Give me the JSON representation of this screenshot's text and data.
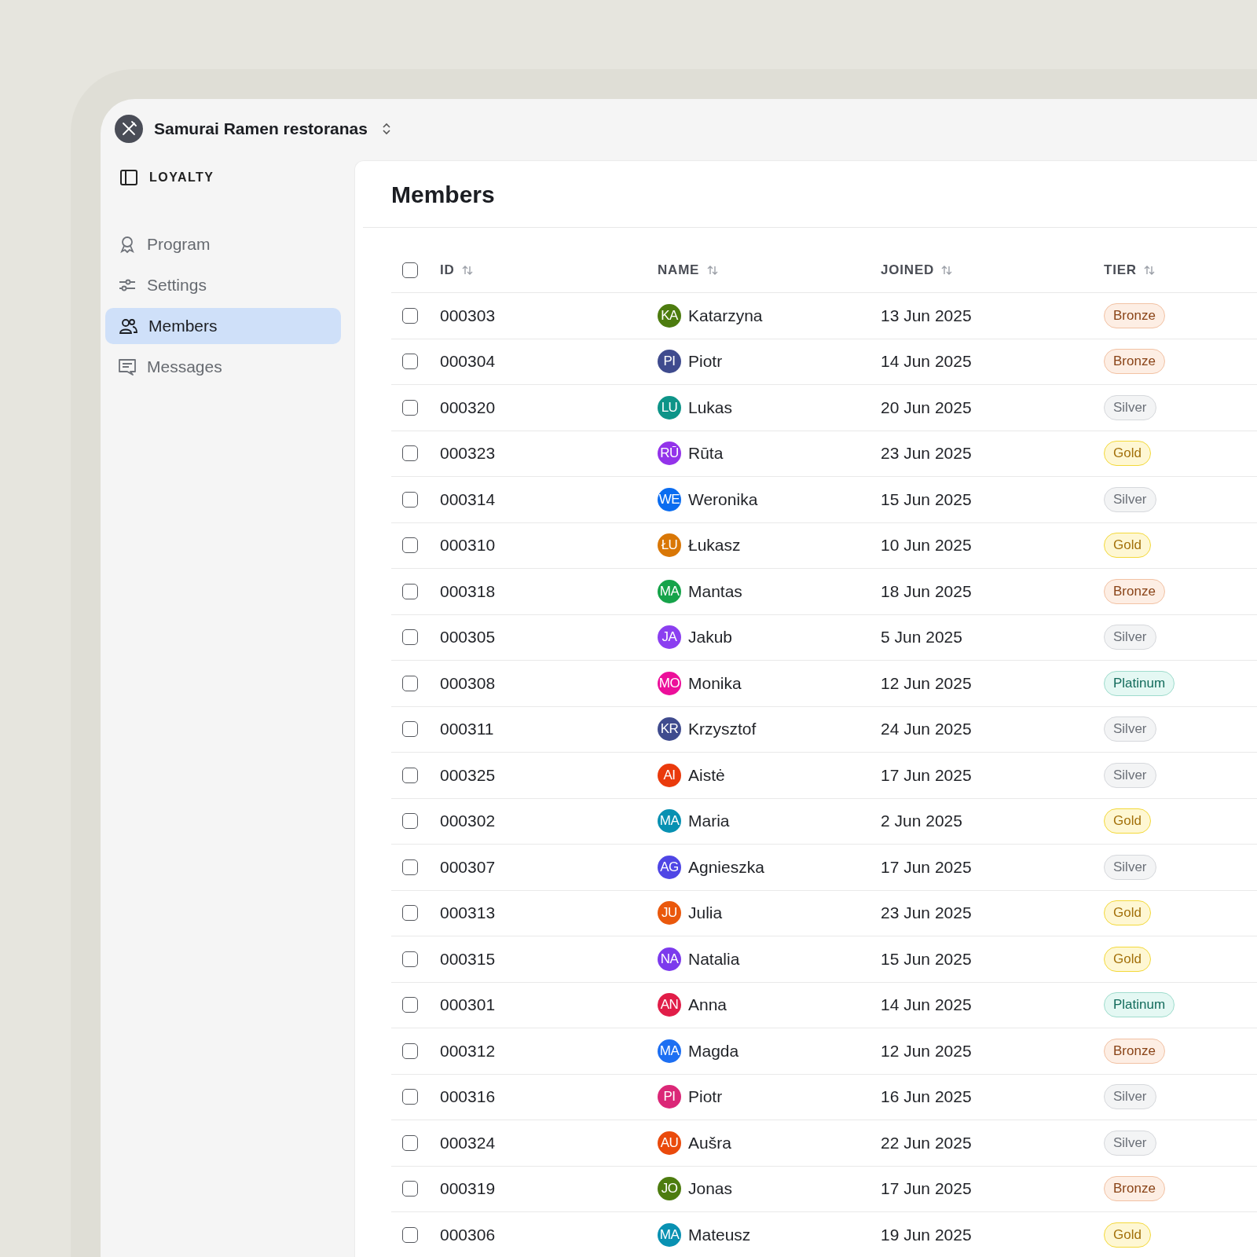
{
  "workspace": {
    "name": "Samurai Ramen restoranas"
  },
  "sidebar": {
    "section": "LOYALTY",
    "items": [
      {
        "label": "Program",
        "selected": false
      },
      {
        "label": "Settings",
        "selected": false
      },
      {
        "label": "Members",
        "selected": true
      },
      {
        "label": "Messages",
        "selected": false
      }
    ]
  },
  "page": {
    "title": "Members"
  },
  "table": {
    "select_all": {
      "checked": false
    },
    "columns": [
      "ID",
      "NAME",
      "JOINED",
      "TIER"
    ],
    "rows": [
      {
        "checked": false,
        "id": "000303",
        "initials": "KA",
        "color": "#4d7c0f",
        "name": "Katarzyna",
        "joined": "13 Jun 2025",
        "tier": "Bronze",
        "kind": "bronze"
      },
      {
        "checked": false,
        "id": "000304",
        "initials": "PI",
        "color": "#3f4b8e",
        "name": "Piotr",
        "joined": "14 Jun 2025",
        "tier": "Bronze",
        "kind": "bronze"
      },
      {
        "checked": false,
        "id": "000320",
        "initials": "LU",
        "color": "#0d9488",
        "name": "Lukas",
        "joined": "20 Jun 2025",
        "tier": "Silver",
        "kind": "silver"
      },
      {
        "checked": false,
        "id": "000323",
        "initials": "RŪ",
        "color": "#9333ea",
        "name": "Rūta",
        "joined": "23 Jun 2025",
        "tier": "Gold",
        "kind": "gold"
      },
      {
        "checked": false,
        "id": "000314",
        "initials": "WE",
        "color": "#0a6cf0",
        "name": "Weronika",
        "joined": "15 Jun 2025",
        "tier": "Silver",
        "kind": "silver"
      },
      {
        "checked": false,
        "id": "000310",
        "initials": "ŁU",
        "color": "#d97706",
        "name": "Łukasz",
        "joined": "10 Jun 2025",
        "tier": "Gold",
        "kind": "gold"
      },
      {
        "checked": false,
        "id": "000318",
        "initials": "MA",
        "color": "#16a34a",
        "name": "Mantas",
        "joined": "18 Jun 2025",
        "tier": "Bronze",
        "kind": "bronze"
      },
      {
        "checked": false,
        "id": "000305",
        "initials": "JA",
        "color": "#8b3ff0",
        "name": "Jakub",
        "joined": "5 Jun 2025",
        "tier": "Silver",
        "kind": "silver"
      },
      {
        "checked": false,
        "id": "000308",
        "initials": "MO",
        "color": "#ec0f9a",
        "name": "Monika",
        "joined": "12 Jun 2025",
        "tier": "Platinum",
        "kind": "platinum"
      },
      {
        "checked": false,
        "id": "000311",
        "initials": "KR",
        "color": "#3f4b8e",
        "name": "Krzysztof",
        "joined": "24 Jun 2025",
        "tier": "Silver",
        "kind": "silver"
      },
      {
        "checked": false,
        "id": "000325",
        "initials": "AI",
        "color": "#ea3a0c",
        "name": "Aistė",
        "joined": "17 Jun 2025",
        "tier": "Silver",
        "kind": "silver"
      },
      {
        "checked": false,
        "id": "000302",
        "initials": "MA",
        "color": "#0891b2",
        "name": "Maria",
        "joined": "2 Jun 2025",
        "tier": "Gold",
        "kind": "gold"
      },
      {
        "checked": false,
        "id": "000307",
        "initials": "AG",
        "color": "#4f46e5",
        "name": "Agnieszka",
        "joined": "17 Jun 2025",
        "tier": "Silver",
        "kind": "silver"
      },
      {
        "checked": false,
        "id": "000313",
        "initials": "JU",
        "color": "#ea580c",
        "name": "Julia",
        "joined": "23 Jun 2025",
        "tier": "Gold",
        "kind": "gold"
      },
      {
        "checked": false,
        "id": "000315",
        "initials": "NA",
        "color": "#7c3aed",
        "name": "Natalia",
        "joined": "15 Jun 2025",
        "tier": "Gold",
        "kind": "gold"
      },
      {
        "checked": false,
        "id": "000301",
        "initials": "AN",
        "color": "#e11d48",
        "name": "Anna",
        "joined": "14 Jun 2025",
        "tier": "Platinum",
        "kind": "platinum"
      },
      {
        "checked": false,
        "id": "000312",
        "initials": "MA",
        "color": "#1d6ff2",
        "name": "Magda",
        "joined": "12 Jun 2025",
        "tier": "Bronze",
        "kind": "bronze"
      },
      {
        "checked": false,
        "id": "000316",
        "initials": "PI",
        "color": "#db2777",
        "name": "Piotr",
        "joined": "16 Jun 2025",
        "tier": "Silver",
        "kind": "silver"
      },
      {
        "checked": false,
        "id": "000324",
        "initials": "AU",
        "color": "#ea4a0c",
        "name": "Aušra",
        "joined": "22 Jun 2025",
        "tier": "Silver",
        "kind": "silver"
      },
      {
        "checked": false,
        "id": "000319",
        "initials": "JO",
        "color": "#4d7c0f",
        "name": "Jonas",
        "joined": "17 Jun 2025",
        "tier": "Bronze",
        "kind": "bronze"
      },
      {
        "checked": false,
        "id": "000306",
        "initials": "MA",
        "color": "#0891b2",
        "name": "Mateusz",
        "joined": "19 Jun 2025",
        "tier": "Gold",
        "kind": "gold"
      }
    ]
  }
}
